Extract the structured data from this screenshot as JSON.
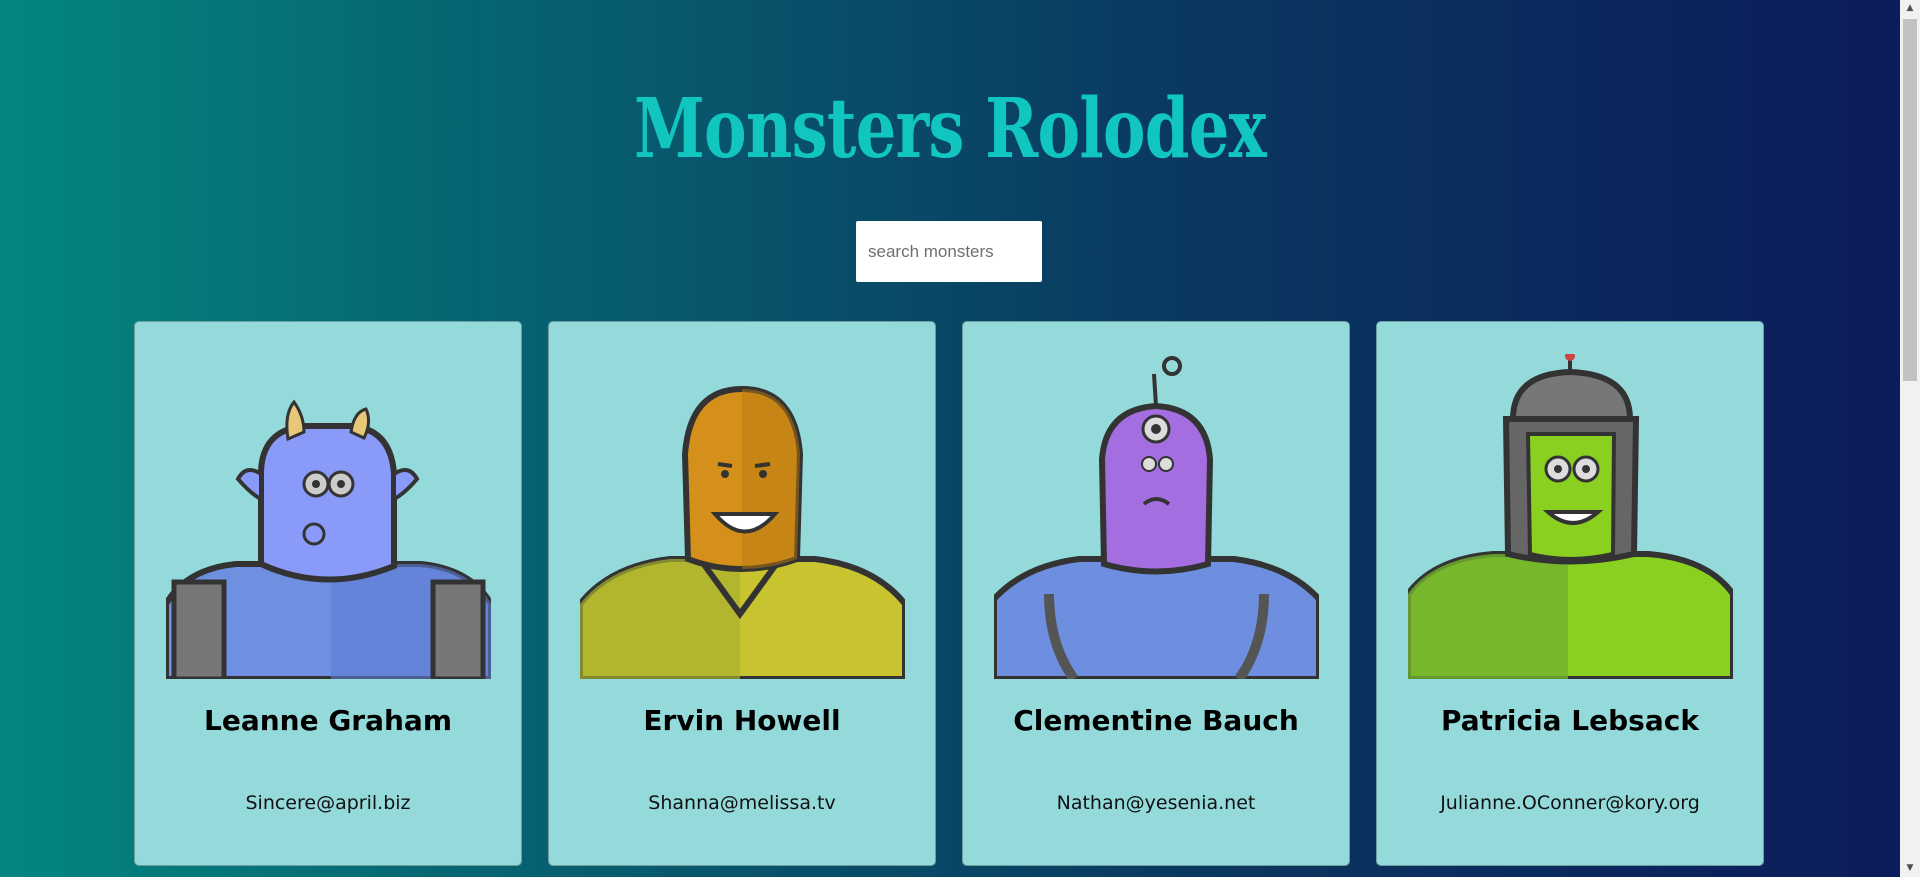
{
  "title": "Monsters Rolodex",
  "search": {
    "placeholder": "search monsters",
    "value": ""
  },
  "monsters": [
    {
      "name": "Leanne Graham",
      "email": "Sincere@april.biz",
      "image_icon": "blue-horned-monster-icon"
    },
    {
      "name": "Ervin Howell",
      "email": "Shanna@melissa.tv",
      "image_icon": "orange-smiling-monster-icon"
    },
    {
      "name": "Clementine Bauch",
      "email": "Nathan@yesenia.net",
      "image_icon": "purple-cyclops-robot-monster-icon"
    },
    {
      "name": "Patricia Lebsack",
      "email": "Julianne.OConner@kory.org",
      "image_icon": "green-helmet-monster-icon"
    }
  ],
  "colors": {
    "title": "#12c6c0",
    "card_background": "#95dada",
    "gradient_left": "#048680",
    "gradient_right": "#0c1a5a"
  },
  "scrollbar": {
    "up_arrow": "▲",
    "down_arrow": "▼"
  }
}
